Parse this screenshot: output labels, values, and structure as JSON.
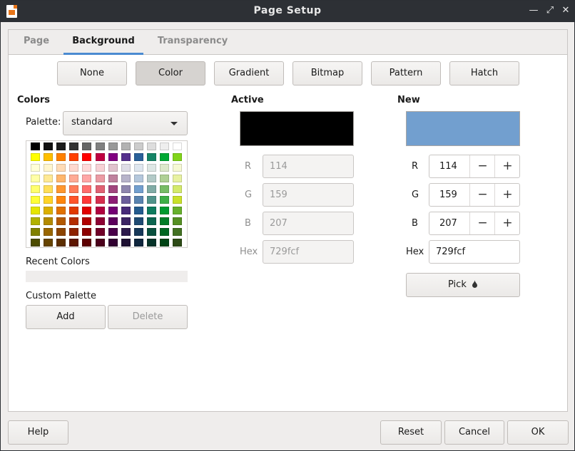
{
  "window": {
    "title": "Page Setup",
    "minimize_icon": "minimize-icon",
    "maximize_icon": "maximize-icon",
    "close_icon": "close-icon"
  },
  "tabs": [
    {
      "label": "Page",
      "active": false
    },
    {
      "label": "Background",
      "active": true
    },
    {
      "label": "Transparency",
      "active": false
    }
  ],
  "fill_types": [
    {
      "label": "None",
      "selected": false
    },
    {
      "label": "Color",
      "selected": true
    },
    {
      "label": "Gradient",
      "selected": false
    },
    {
      "label": "Bitmap",
      "selected": false
    },
    {
      "label": "Pattern",
      "selected": false
    },
    {
      "label": "Hatch",
      "selected": false
    }
  ],
  "colors": {
    "title": "Colors",
    "palette_label": "Palette:",
    "palette_value": "standard",
    "recent_label": "Recent Colors",
    "custom_label": "Custom Palette",
    "add_label": "Add",
    "delete_label": "Delete",
    "swatches": [
      [
        "#000000",
        "#111111",
        "#1c1c1c",
        "#333333",
        "#666666",
        "#808080",
        "#999999",
        "#b2b2b2",
        "#cccccc",
        "#dddddd",
        "#eeeeee",
        "#ffffff"
      ],
      [
        "#ffff00",
        "#ffbf00",
        "#ff8000",
        "#ff4000",
        "#ff0000",
        "#bf0041",
        "#800080",
        "#55308d",
        "#2a6099",
        "#158466",
        "#00a933",
        "#81d41a"
      ],
      [
        "#ffffd7",
        "#fff5ce",
        "#ffdbb6",
        "#ffd8ce",
        "#ffd7d7",
        "#f7d1d5",
        "#e0c2cd",
        "#dedce6",
        "#dee6ef",
        "#dee7e5",
        "#dde8cb",
        "#f6f9d4"
      ],
      [
        "#ffffa6",
        "#ffe994",
        "#ffb66c",
        "#ffaa95",
        "#ffa6a6",
        "#ec9ba4",
        "#bf819e",
        "#b7b3ca",
        "#b4c7dc",
        "#b3cac7",
        "#afd095",
        "#e8f2a1"
      ],
      [
        "#ffff6d",
        "#ffde59",
        "#ff972f",
        "#ff7b59",
        "#ff6d6d",
        "#e16173",
        "#a1467e",
        "#8e86ae",
        "#729fcf",
        "#81aca6",
        "#77bc65",
        "#d4ea6b"
      ],
      [
        "#ffff38",
        "#ffd428",
        "#ff860d",
        "#ff5429",
        "#ff3838",
        "#d62e4e",
        "#8d1d75",
        "#6b5e9b",
        "#5983b0",
        "#50938a",
        "#3faf46",
        "#c9e12a"
      ],
      [
        "#e6e600",
        "#dcb000",
        "#e17100",
        "#e13900",
        "#e00000",
        "#b0003f",
        "#730073",
        "#472b79",
        "#245b8e",
        "#0e7c5e",
        "#009a2e",
        "#67b02c"
      ],
      [
        "#b2b200",
        "#b38a00",
        "#b35900",
        "#b32d00",
        "#b00000",
        "#8c0033",
        "#5c005c",
        "#3b2464",
        "#1f4a73",
        "#0c6650",
        "#007d26",
        "#558f23"
      ],
      [
        "#808000",
        "#996600",
        "#8c4400",
        "#8c2200",
        "#8c0000",
        "#700028",
        "#490049",
        "#2c1a4c",
        "#173859",
        "#09503e",
        "#006620",
        "#437123"
      ],
      [
        "#4c4c00",
        "#664400",
        "#5c2e00",
        "#5c1600",
        "#5c0000",
        "#4a001b",
        "#310031",
        "#1e1133",
        "#0f263d",
        "#063329",
        "#004415",
        "#2d4a16"
      ]
    ]
  },
  "active": {
    "title": "Active",
    "preview_color": "#000000",
    "r_label": "R",
    "r_value": "114",
    "g_label": "G",
    "g_value": "159",
    "b_label": "B",
    "b_value": "207",
    "hex_label": "Hex",
    "hex_value": "729fcf"
  },
  "new": {
    "title": "New",
    "preview_color": "#729fcf",
    "r_label": "R",
    "r_value": "114",
    "g_label": "G",
    "g_value": "159",
    "b_label": "B",
    "b_value": "207",
    "hex_label": "Hex",
    "hex_value": "729fcf",
    "minus": "−",
    "plus": "+",
    "pick_label": "Pick",
    "pick_icon": "eyedropper-icon"
  },
  "footer": {
    "help": "Help",
    "reset": "Reset",
    "cancel": "Cancel",
    "ok": "OK"
  }
}
